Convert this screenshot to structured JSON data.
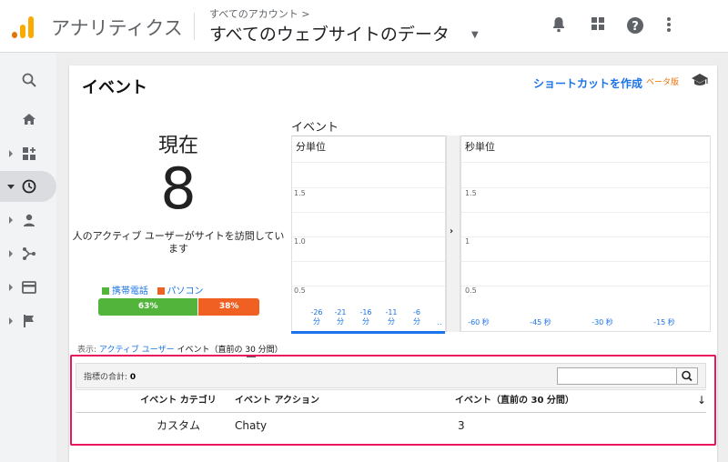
{
  "header": {
    "app_title": "アナリティクス",
    "breadcrumb": "すべてのアカウント >",
    "property_title": "すべてのウェブサイトのデータ"
  },
  "page": {
    "title": "イベント",
    "shortcut_label": "ショートカットを作成",
    "beta_label": "ベータ版"
  },
  "realtime": {
    "now_label": "現在",
    "active_users": "8",
    "description": "人のアクティブ ユーザーがサイトを訪問しています",
    "legend_mobile": "携帯電話",
    "legend_desktop": "パソコン",
    "mobile_pct": "63%",
    "desktop_pct": "38%",
    "mobile_share": 63,
    "desktop_share": 38,
    "mobile_color": "#52b43b",
    "desktop_color": "#f06022"
  },
  "charts": {
    "section_label": "イベント",
    "per_minute": {
      "title": "分単位",
      "y_ticks": [
        "1.5",
        "1.0",
        "0.5"
      ],
      "x_ticks": [
        "-26 分",
        "-21 分",
        "-16 分",
        "-11 分",
        "-6 分",
        ".."
      ]
    },
    "per_second": {
      "title": "秒単位",
      "y_ticks": [
        "1.5",
        "1",
        "0.5"
      ],
      "x_ticks": [
        "-60 秒",
        "-45 秒",
        "-30 秒",
        "-15 秒"
      ]
    }
  },
  "display": {
    "label": "表示:",
    "link": "アクティブ ユーザー",
    "current": "イベント（直前の 30 分間）"
  },
  "table": {
    "metric_label": "指標の合計:",
    "metric_value": "0",
    "search_placeholder": "",
    "columns": [
      "イベント カテゴリ",
      "イベント アクション",
      "イベント（直前の 30 分間）"
    ],
    "rows": [
      [
        "カスタム",
        "Chaty",
        "3"
      ]
    ]
  },
  "colors": {
    "accent": "#1a73e8",
    "highlight_border": "#e8175d"
  }
}
